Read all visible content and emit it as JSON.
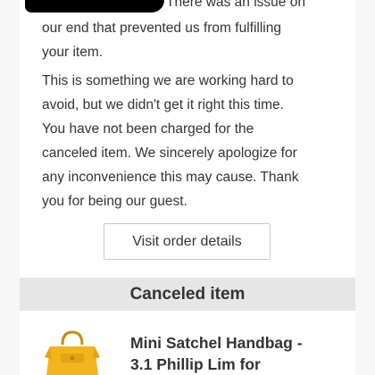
{
  "message": {
    "lines": [
      "There was an issue on",
      "our end that prevented us from fulfilling",
      "your item.",
      "This is something we are working hard to",
      "avoid, but we didn't get it right this time.",
      "You have not been charged for the",
      "canceled item. We sincerely apologize for",
      "any inconvenience this may cause. Thank",
      "you for being our guest."
    ]
  },
  "actions": {
    "visit_order_details": "Visit order details"
  },
  "canceled_section": {
    "heading": "Canceled item",
    "item": {
      "title_line1": "Mini Satchel Handbag -",
      "title_line2": "3.1 Phillip Lim for",
      "image_icon": "handbag-icon"
    }
  },
  "colors": {
    "background": "#f7f7f7",
    "card": "#ffffff",
    "header_band": "#e6e6e6",
    "text": "#333333",
    "handbag": "#f2b51d"
  }
}
